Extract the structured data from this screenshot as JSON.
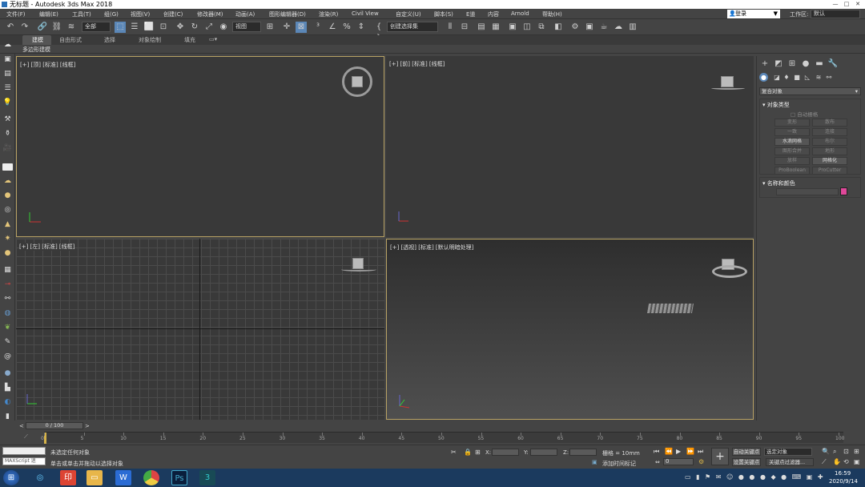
{
  "window": {
    "title": "无标题 - Autodesk 3ds Max 2018"
  },
  "menubar": {
    "items": [
      "文件(F)",
      "编辑(E)",
      "工具(T)",
      "组(G)",
      "视图(V)",
      "创建(C)",
      "修改器(M)",
      "动画(A)",
      "图形编辑器(D)",
      "渲染(R)",
      "Civil View",
      "自定义(U)",
      "脚本(S)",
      "E道",
      "内容",
      "Arnold",
      "帮助(H)"
    ],
    "login": "登录",
    "workspace_label": "工作区:",
    "workspace_value": "默认"
  },
  "toolbar": {
    "filter_value": "全部",
    "refcoord_value": "视图",
    "selection_set_value": "创建选择集"
  },
  "ribbon": {
    "tabs": [
      "建模",
      "自由形式",
      "选择",
      "对象绘制",
      "填充"
    ],
    "panel_label": "多边形建模"
  },
  "viewports": [
    {
      "label": "[+] [顶] [标准] [线框]"
    },
    {
      "label": "[+] [前] [标准] [线框]"
    },
    {
      "label": "[+] [左] [标准] [线框]"
    },
    {
      "label": "[+] [透视] [标准] [默认明暗处理]"
    }
  ],
  "command_panel": {
    "category_value": "复合对象",
    "rollout_object_type": "对象类型",
    "autogrid_label": "自动栅格",
    "buttons": [
      "变形",
      "散布",
      "一致",
      "连接",
      "水滴网格",
      "图形合并",
      "地形",
      "放样",
      "网格化",
      "ProBoolean",
      "ProCutter"
    ],
    "rollout_name_color": "名称和颜色",
    "swatch_color": "#e0489a"
  },
  "timeline": {
    "frame_counter": "0 / 100",
    "ticks": [
      "0",
      "5",
      "10",
      "15",
      "20",
      "25",
      "30",
      "35",
      "40",
      "45",
      "50",
      "55",
      "60",
      "65",
      "70",
      "75",
      "80",
      "85",
      "90",
      "95",
      "100"
    ]
  },
  "status": {
    "maxscript_label": "MAXScript 迷",
    "line1": "未选定任何对象",
    "line2": "单击或单击并拖动以选择对象",
    "x_label": "X:",
    "y_label": "Y:",
    "z_label": "Z:",
    "grid_text": "栅格 = 10mm",
    "add_time_tag": "添加时间标记",
    "auto_key": "自动关键点",
    "set_key": "设置关键点",
    "selected_object": "选定对象",
    "key_filters": "关键点过滤器...",
    "current_frame": "0"
  },
  "taskbar": {
    "time": "16:59",
    "date": "2020/9/14"
  }
}
